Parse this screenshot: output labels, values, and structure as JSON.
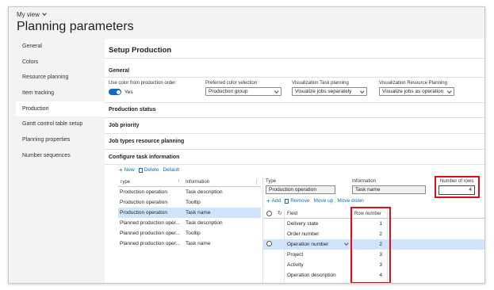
{
  "header": {
    "my_view": "My view",
    "title": "Planning parameters"
  },
  "sidebar": {
    "items": [
      {
        "label": "General"
      },
      {
        "label": "Colors"
      },
      {
        "label": "Resource planning"
      },
      {
        "label": "Item tracking"
      },
      {
        "label": "Production"
      },
      {
        "label": "Gantt control table setup"
      },
      {
        "label": "Planning properties"
      },
      {
        "label": "Number sequences"
      }
    ],
    "active": "Production"
  },
  "main": {
    "title": "Setup Production",
    "general": {
      "header": "General",
      "use_color_label": "Use color from production order",
      "use_color_value": "Yes",
      "preferred_color_label": "Preferred color selection",
      "preferred_color_value": "Production group",
      "vis_task_label": "Visualization Task planning",
      "vis_task_value": "Visualize jobs separately",
      "vis_resource_label": "Visualization Resource Planning",
      "vis_resource_value": "Visualize jobs as operation"
    },
    "sections": {
      "production_status": "Production status",
      "job_priority": "Job priority",
      "job_types": "Job types resource planning",
      "configure_task": "Configure task information"
    },
    "left_toolbar": {
      "new": "New",
      "delete": "Delete",
      "default": "Default"
    },
    "left_grid": {
      "col_type": "Type",
      "col_info": "Information",
      "rows": [
        {
          "type": "Production operation",
          "info": "Task description"
        },
        {
          "type": "Production operation",
          "info": "Tooltip"
        },
        {
          "type": "Production operation",
          "info": "Task name"
        },
        {
          "type": "Planned production oper...",
          "info": "Task description"
        },
        {
          "type": "Planned production oper...",
          "info": "Tooltip"
        },
        {
          "type": "Planned production oper...",
          "info": "Task name"
        }
      ]
    },
    "detail": {
      "type_label": "Type",
      "type_value": "Production operation",
      "info_label": "Information",
      "info_value": "Task name",
      "rows_label": "Number of rows",
      "rows_value": "4"
    },
    "right_toolbar": {
      "add": "Add",
      "remove": "Remove",
      "move_up": "Move up",
      "move_down": "Move down"
    },
    "right_grid": {
      "col_field": "Field",
      "col_row": "Row number",
      "rows": [
        {
          "field": "Delivery state",
          "row": "1"
        },
        {
          "field": "Order number",
          "row": "2"
        },
        {
          "field": "Operation number",
          "row": "2"
        },
        {
          "field": "Project",
          "row": "3"
        },
        {
          "field": "Activity",
          "row": "3"
        },
        {
          "field": "Operation description",
          "row": "4"
        }
      ]
    },
    "accent_color": "#0f6cbd",
    "highlight_color": "#e0101a"
  }
}
